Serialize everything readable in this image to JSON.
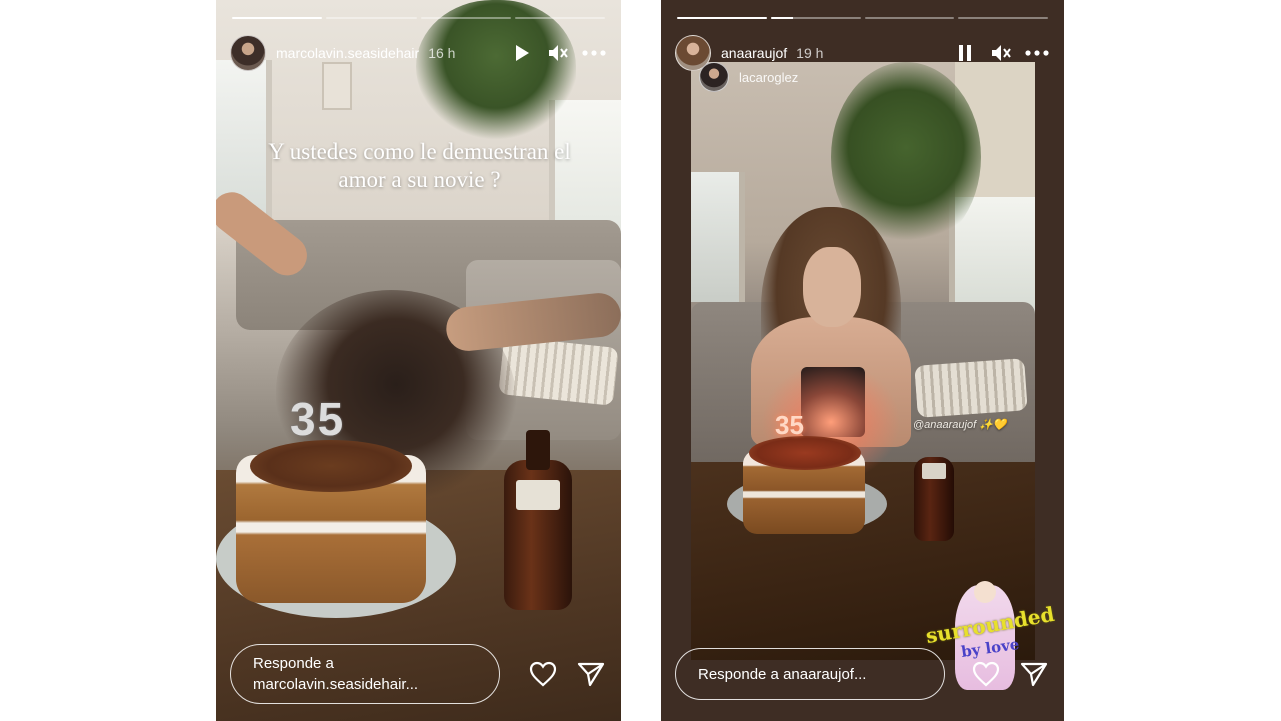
{
  "stories": [
    {
      "username": "marcolavin.seasidehair",
      "time_ago": "16 h",
      "progress": [
        1.0,
        0,
        0,
        0
      ],
      "caption": "Y ustedes como le demuestran  el amor a su novie ?",
      "candle_number": "35",
      "reply_placeholder": "Responde a marcolavin.seasidehair...",
      "icons": {
        "play": "play-icon",
        "mute": "mute-icon",
        "more": "more-icon",
        "like": "heart-icon",
        "share": "send-icon"
      }
    },
    {
      "username": "anaaraujof",
      "time_ago": "19 h",
      "collaborator": "lacaroglez",
      "progress": [
        1.0,
        0.25,
        0,
        0
      ],
      "photo_tag": "@anaaraujof ✨💛",
      "candle_number": "35",
      "sticker_text_1": "surrounded",
      "sticker_text_2": "by love",
      "reply_placeholder": "Responde a anaaraujof...",
      "icons": {
        "pause": "pause-icon",
        "mute": "mute-icon",
        "more": "more-icon",
        "like": "heart-icon",
        "share": "send-icon"
      }
    }
  ]
}
